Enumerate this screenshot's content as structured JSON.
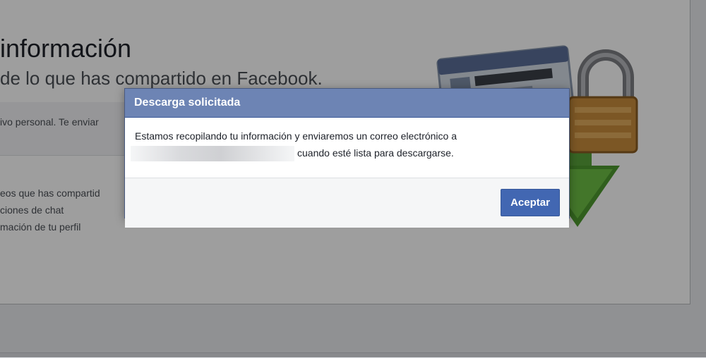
{
  "background_page": {
    "title": "información",
    "subtitle": "de lo que has compartido en Facebook.",
    "band_text": "ivo personal. Te enviar",
    "list_items": [
      "eos que has compartid",
      "ciones de chat",
      "mación de tu perfil"
    ]
  },
  "dialog": {
    "title": "Descarga solicitada",
    "message_line1": "Estamos recopilando tu información y enviaremos un correo electrónico a",
    "message_line2": "cuando esté lista para descargarse.",
    "accept_label": "Aceptar"
  },
  "colors": {
    "header_bg": "#6d84b4",
    "button_bg": "#4267b2",
    "overlay": "rgba(0,0,0,0.38)"
  },
  "icons": [
    "id-card-icon",
    "padlock-icon",
    "download-arrow-icon"
  ]
}
